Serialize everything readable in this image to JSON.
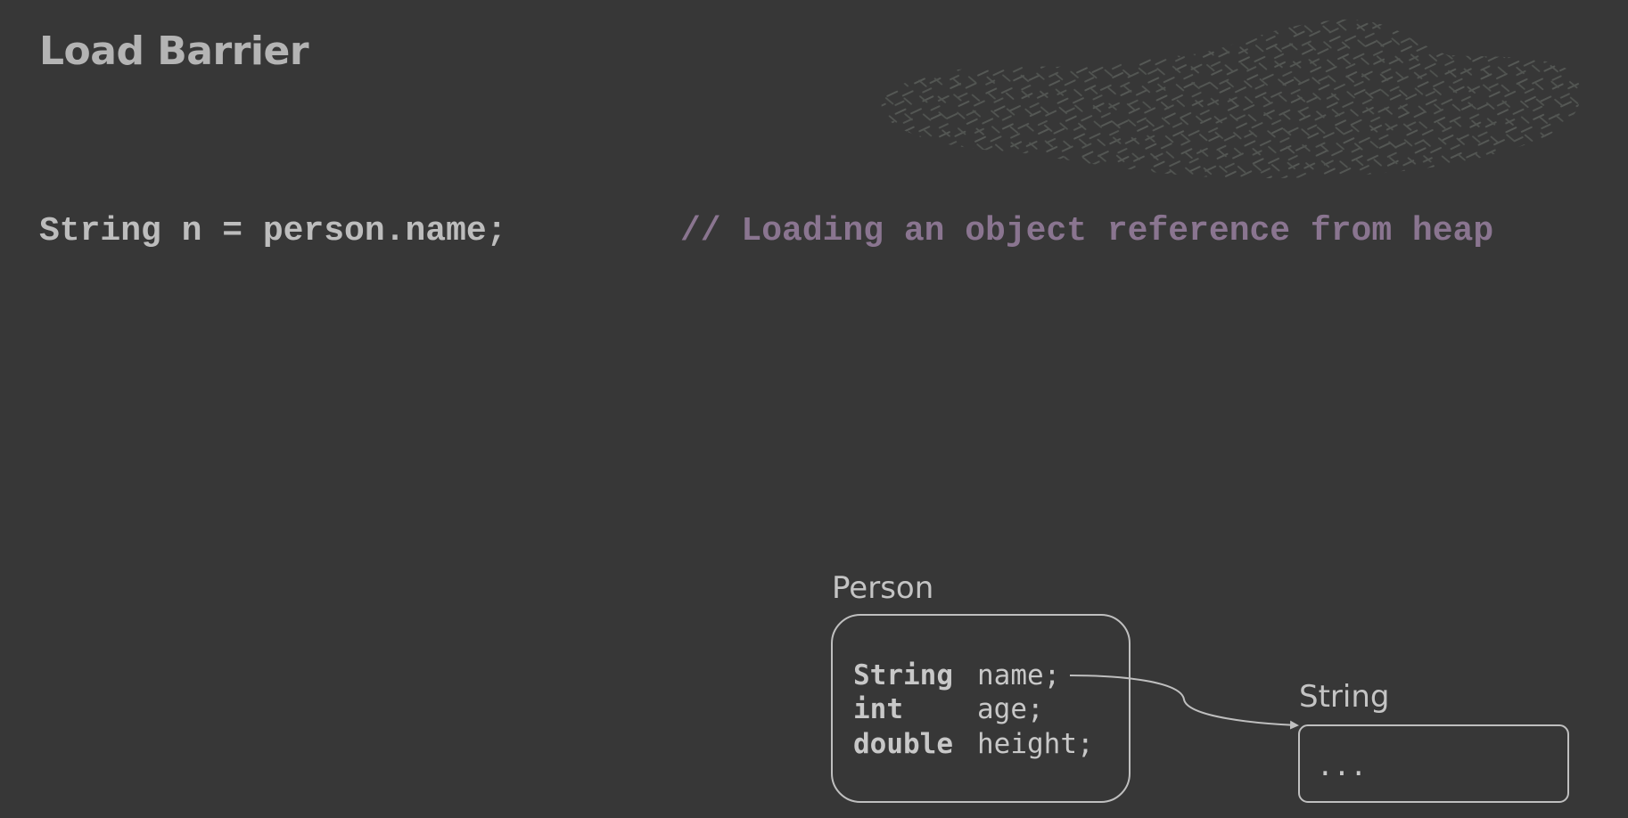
{
  "slide": {
    "title": "Load Barrier",
    "code": "String n = person.name;",
    "comment": "// Loading an object reference from heap"
  },
  "person_object": {
    "label": "Person",
    "fields": [
      {
        "type": "String",
        "name": "name;"
      },
      {
        "type": "int",
        "name": "age;"
      },
      {
        "type": "double",
        "name": "height;"
      }
    ]
  },
  "string_object": {
    "label": "String",
    "content": "..."
  },
  "colors": {
    "background": "#373737",
    "text": "#bdbdbd",
    "comment": "#8a7590",
    "stroke": "#bfbfbf",
    "heap": "#4f524f"
  }
}
